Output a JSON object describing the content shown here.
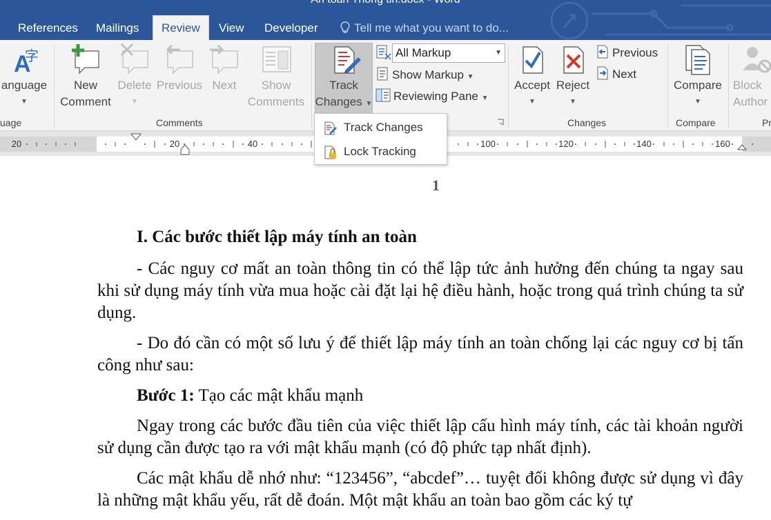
{
  "window": {
    "title": "An toàn Thông tin.docx - Word"
  },
  "tabs": [
    {
      "label": "References"
    },
    {
      "label": "Mailings"
    },
    {
      "label": "Review",
      "active": true
    },
    {
      "label": "View"
    },
    {
      "label": "Developer"
    }
  ],
  "tell_me": {
    "placeholder": "Tell me what you want to do..."
  },
  "ribbon": {
    "language": {
      "label": "anguage",
      "group": "uage"
    },
    "comments": {
      "group": "Comments",
      "new_line1": "New",
      "new_line2": "Comment",
      "delete": "Delete",
      "previous": "Previous",
      "next": "Next",
      "show_line1": "Show",
      "show_line2": "Comments"
    },
    "tracking": {
      "track_line1": "Track",
      "track_line2": "Changes",
      "markup_value": "All Markup",
      "show_markup": "Show Markup",
      "reviewing_pane": "Reviewing Pane"
    },
    "changes": {
      "group": "Changes",
      "accept": "Accept",
      "reject": "Reject",
      "previous": "Previous",
      "next": "Next"
    },
    "compare": {
      "group": "Compare",
      "label": "Compare"
    },
    "protect": {
      "line1": "Block",
      "line2": "Author",
      "group": "Pr"
    }
  },
  "dropdown": {
    "items": [
      "Track Changes",
      "Lock Tracking"
    ]
  },
  "ruler": {
    "labels": [
      "20",
      "20",
      "40",
      "100",
      "120",
      "140",
      "160"
    ]
  },
  "document": {
    "page_number": "1",
    "heading": "I. Các bước thiết lập máy tính an toàn",
    "p1": "- Các nguy cơ mất an toàn thông tin có thể lập tức ảnh hưởng đến chúng ta ngay sau khi sử dụng máy tính vừa mua hoặc cài đặt lại hệ điều hành, hoặc trong quá trình chúng ta sử dụng.",
    "p2": "- Do đó cần có một số lưu ý để thiết lập máy tính an toàn chống lại các nguy cơ bị tấn công như sau:",
    "step1_bold": "Bước 1:",
    "step1_text": " Tạo các mật khẩu mạnh",
    "p3": "Ngay trong các bước đầu tiên của việc thiết lập cấu hình máy tính, các tài khoản người sử dụng cần được tạo ra với mật khẩu mạnh (có độ phức tạp nhất định).",
    "p4": "Các mật khẩu dễ nhớ như: “123456”, “abcdef”… tuyệt đối không được sử dụng vì đây là những mật khẩu yếu, rất dễ đoán. Một mật khẩu an toàn bao gồm các ký tự"
  }
}
